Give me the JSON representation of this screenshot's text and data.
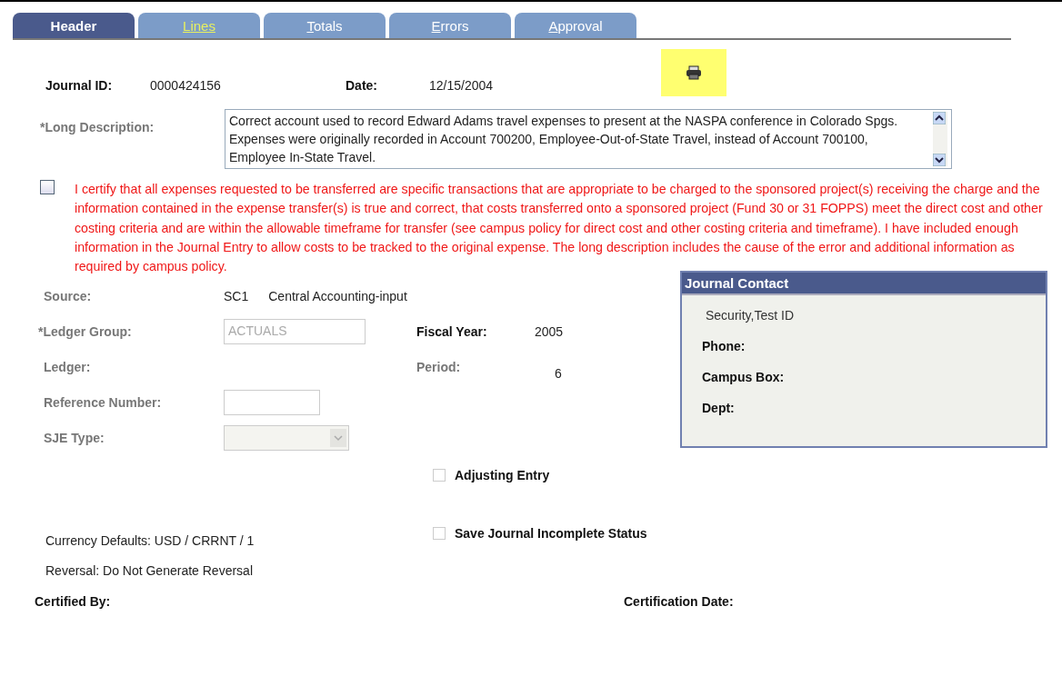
{
  "tabs": [
    {
      "label": "Header",
      "selected": true,
      "visited": false
    },
    {
      "label": "Lines",
      "selected": false,
      "visited": true
    },
    {
      "label": "Totals",
      "selected": false,
      "visited": false
    },
    {
      "label": "Errors",
      "selected": false,
      "visited": false
    },
    {
      "label": "Approval",
      "selected": false,
      "visited": false
    }
  ],
  "journal_id": {
    "label": "Journal ID:",
    "value": "0000424156"
  },
  "date": {
    "label": "Date:",
    "value": "12/15/2004"
  },
  "long_description": {
    "label": "*Long Description:",
    "value": "Correct account used to record Edward Adams travel expenses to present at the NASPA conference in Colorado Spgs.  Expenses were originally recorded in Account 700200, Employee-Out-of-State Travel, instead of Account 700100, Employee In-State Travel."
  },
  "certification": {
    "checked": false,
    "text": "I certify that all expenses requested to be transferred are specific transactions that are appropriate to be charged to the sponsored project(s) receiving the charge and the information contained in the expense transfer(s) is true and correct, that costs transferred onto a sponsored project (Fund 30 or 31 FOPPS) meet the direct cost and other costing criteria and are within the allowable timeframe for transfer (see campus policy for direct cost and other costing criteria and timeframe). I have included enough information in the Journal Entry to allow costs to be tracked to the original expense. The long description includes the cause of the error and additional information as required by campus policy."
  },
  "source": {
    "label": "Source:",
    "code": "SC1",
    "description": "Central Accounting-input"
  },
  "ledger_group": {
    "label": "*Ledger Group:",
    "value": "ACTUALS",
    "disabled": true
  },
  "ledger": {
    "label": "Ledger:"
  },
  "reference_number": {
    "label": "Reference Number:"
  },
  "sje_type": {
    "label": "SJE Type:",
    "disabled": true
  },
  "fiscal_year": {
    "label": "Fiscal Year:",
    "value": "2005"
  },
  "period": {
    "label": "Period:",
    "value": "6"
  },
  "journal_contact": {
    "title": "Journal Contact",
    "name": "Security,Test ID",
    "fields": [
      "Phone:",
      "Campus Box:",
      "Dept:"
    ]
  },
  "adjusting_entry": {
    "label": "Adjusting Entry",
    "checked": false
  },
  "save_incomplete": {
    "label": "Save Journal Incomplete Status",
    "checked": false
  },
  "currency_defaults": "Currency Defaults: USD / CRRNT / 1",
  "reversal": "Reversal: Do Not Generate Reversal",
  "certified_by": {
    "label": "Certified By:"
  },
  "certification_date": {
    "label": "Certification Date:"
  }
}
